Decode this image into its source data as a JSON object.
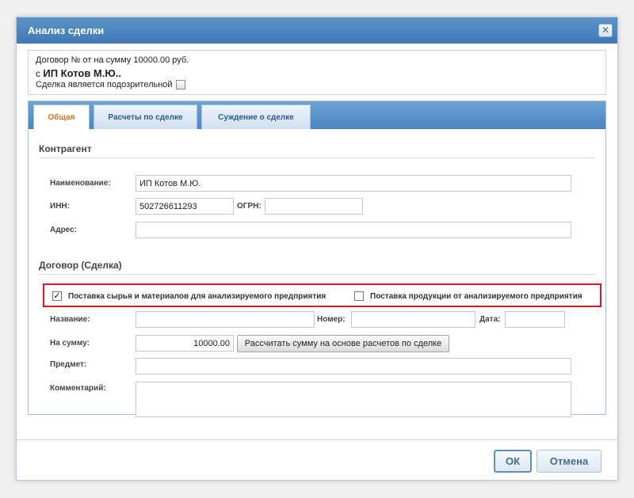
{
  "dialog": {
    "title": "Анализ сделки",
    "close_glyph": "✕"
  },
  "deal_info": {
    "contract_line": "Договор № от на сумму 10000.00 руб.",
    "party_prefix": "с",
    "party_name": "ИП Котов М.Ю..",
    "suspicious_label": "Сделка является подозрительной",
    "suspicious_checked": false
  },
  "tabs": [
    {
      "label": "Общая",
      "active": true
    },
    {
      "label": "Расчеты по сделке",
      "active": false
    },
    {
      "label": "Суждение о сделке",
      "active": false
    }
  ],
  "counterparty": {
    "section_title": "Контрагент",
    "name_label": "Наименование:",
    "name_value": "ИП Котов М.Ю.",
    "inn_label": "ИНН:",
    "inn_value": "502726611293",
    "ogrn_label": "ОГРН:",
    "ogrn_value": "",
    "address_label": "Адрес:",
    "address_value": ""
  },
  "contract": {
    "section_title": "Договор (Сделка)",
    "option_supply_materials": {
      "label": "Поставка сырья и материалов для анализируемого предприятия",
      "checked": true
    },
    "option_supply_products": {
      "label": "Поставка продукции от анализируемого предприятия",
      "checked": false
    },
    "title_label": "Название:",
    "title_value": "",
    "number_label": "Номер:",
    "number_value": "",
    "date_label": "Дата:",
    "date_value": "",
    "sum_label": "На сумму:",
    "sum_value": "10000.00",
    "calc_button": "Рассчитать сумму на основе расчетов по сделке",
    "subject_label": "Предмет:",
    "subject_value": "",
    "comment_label": "Комментарий:",
    "comment_value": ""
  },
  "footer": {
    "ok_label": "ОК",
    "cancel_label": "Отмена"
  },
  "colors": {
    "titlebar": "#4a86c2",
    "active_tab_text": "#e07020",
    "highlight_border": "#e0141e"
  }
}
